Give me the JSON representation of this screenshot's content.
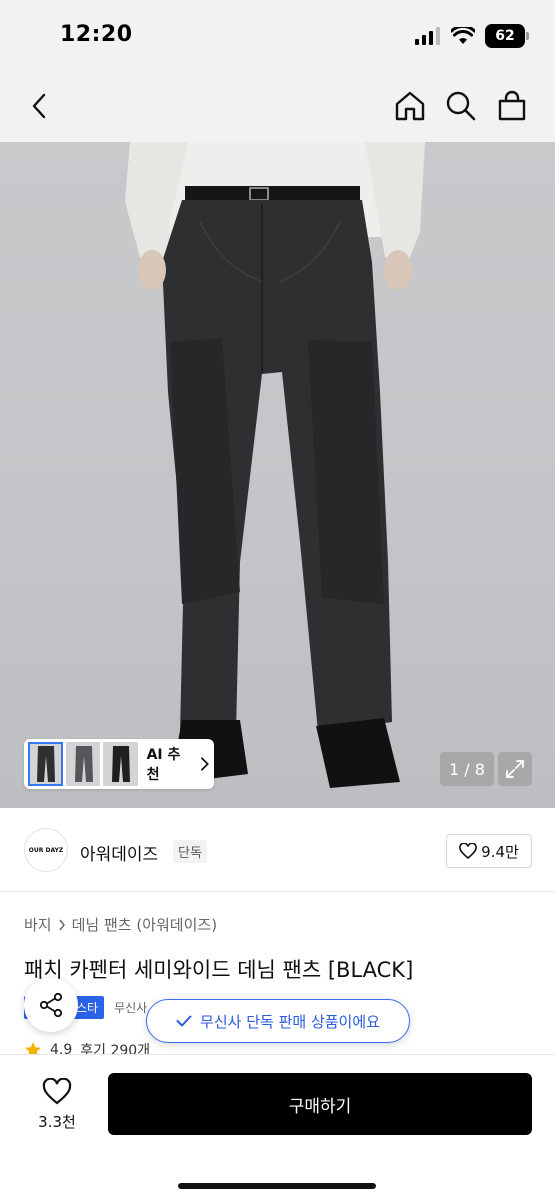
{
  "status_bar": {
    "time": "12:20",
    "battery": "62"
  },
  "nav": {
    "icons": [
      "chevron-left-icon",
      "home-icon",
      "search-icon",
      "shopping-bag-icon"
    ]
  },
  "gallery": {
    "thumb_label": "AI 추천",
    "page_indicator": "1 / 8"
  },
  "brand": {
    "logo_text": "OUR DAYZ",
    "name": "아워데이즈",
    "tag": "단독",
    "likes": "9.4만"
  },
  "breadcrumb": {
    "category": "바지",
    "subcategory": "데님 팬츠 (아워데이즈)"
  },
  "product": {
    "title": "패치 카펜터 세미와이드 데님 팬츠 [BLACK]",
    "badge_blue": "스타",
    "badge_gray": "무신사",
    "rating": "4.9",
    "reviews": "후기 290개"
  },
  "toast": {
    "text": "무신사 단독 판매 상품이에요"
  },
  "bottom": {
    "wish_count": "3.3천",
    "buy_label": "구매하기"
  },
  "colors": {
    "accent_blue": "#2a63e8",
    "buy_button": "#000000"
  }
}
